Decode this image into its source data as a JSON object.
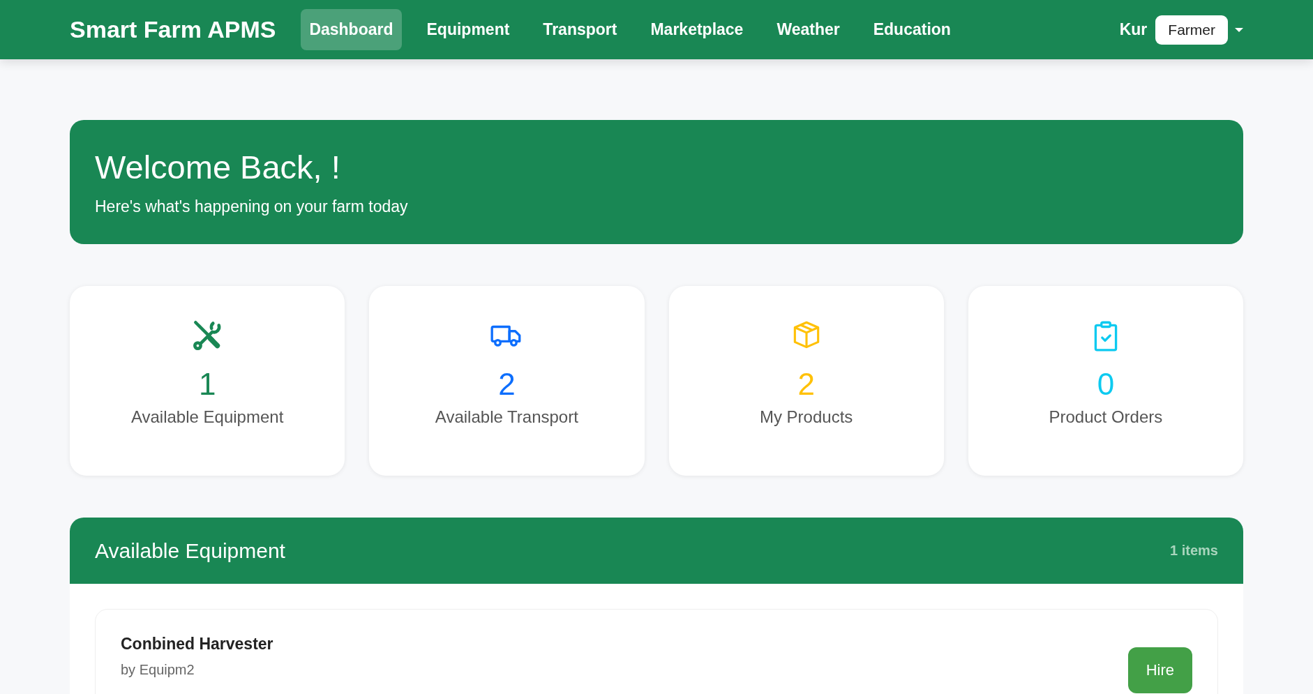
{
  "navbar": {
    "brand": "Smart Farm APMS",
    "links": [
      {
        "label": "Dashboard",
        "selected": true
      },
      {
        "label": "Equipment",
        "selected": false
      },
      {
        "label": "Transport",
        "selected": false
      },
      {
        "label": "Marketplace",
        "selected": false
      },
      {
        "label": "Weather",
        "selected": false
      },
      {
        "label": "Education",
        "selected": false
      }
    ],
    "user": "Kur",
    "role": "Farmer"
  },
  "welcome": {
    "title": "Welcome Back, !",
    "subtitle": "Here's what's happening on your farm today"
  },
  "stats": [
    {
      "kind": "tools",
      "value": "1",
      "label": "Available Equipment",
      "color": "#198754"
    },
    {
      "kind": "truck",
      "value": "2",
      "label": "Available Transport",
      "color": "#0d6efd"
    },
    {
      "kind": "box",
      "value": "2",
      "label": "My Products",
      "color": "#ffc107"
    },
    {
      "kind": "clipboard",
      "value": "0",
      "label": "Product Orders",
      "color": "#0dcaf0"
    }
  ],
  "section": {
    "title": "Available Equipment",
    "count": "1 items",
    "items": [
      {
        "name": "Conbined Harvester",
        "owner": "by Equipm2",
        "action": "Hire"
      }
    ]
  }
}
